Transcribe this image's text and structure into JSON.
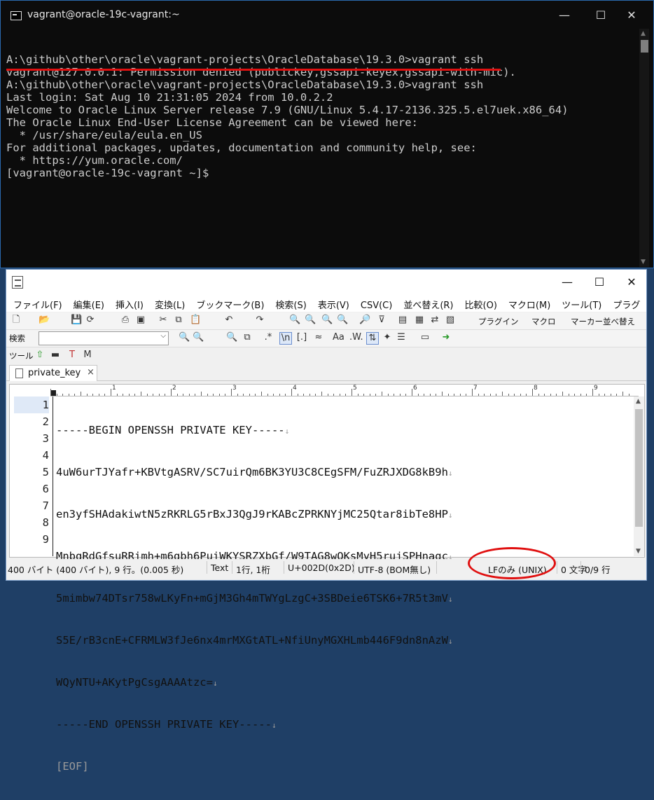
{
  "terminal": {
    "title": "vagrant@oracle-19c-vagrant:~",
    "lines": [
      "A:\\github\\other\\oracle\\vagrant-projects\\OracleDatabase\\19.3.0>vagrant ssh",
      "vagrant@127.0.0.1: Permission denied (publickey,gssapi-keyex,gssapi-with-mic).",
      "",
      "A:\\github\\other\\oracle\\vagrant-projects\\OracleDatabase\\19.3.0>vagrant ssh",
      "Last login: Sat Aug 10 21:31:05 2024 from 10.0.2.2",
      "",
      "Welcome to Oracle Linux Server release 7.9 (GNU/Linux 5.4.17-2136.325.5.el7uek.x86_64)",
      "",
      "The Oracle Linux End-User License Agreement can be viewed here:",
      "",
      "  * /usr/share/eula/eula.en_US",
      "",
      "For additional packages, updates, documentation and community help, see:",
      "",
      "  * https://yum.oracle.com/",
      "",
      "[vagrant@oracle-19c-vagrant ~]$"
    ],
    "window_buttons": {
      "minimize": "—",
      "maximize": "☐",
      "close": "✕"
    }
  },
  "editor": {
    "window_buttons": {
      "minimize": "—",
      "maximize": "☐",
      "close": "✕"
    },
    "menu": [
      "ファイル(F)",
      "編集(E)",
      "挿入(I)",
      "変換(L)",
      "ブックマーク(B)",
      "検索(S)",
      "表示(V)",
      "CSV(C)",
      "並べ替え(R)",
      "比較(O)",
      "マクロ(M)",
      "ツール(T)",
      "プラグ"
    ],
    "toolbar_labels": {
      "plugin": "プラグイン",
      "macro": "マクロ",
      "marker": "マーカー",
      "sort": "並べ替え"
    },
    "search": {
      "label": "検索",
      "value": ""
    },
    "tools_label": "ツール",
    "tab": {
      "name": "private_key",
      "close": "×"
    },
    "ruler_labels": [
      "1",
      "2",
      "3",
      "4",
      "5",
      "6",
      "7",
      "8",
      "9"
    ],
    "lines": [
      {
        "num": "1",
        "text": "-----BEGIN OPENSSH PRIVATE KEY-----"
      },
      {
        "num": "2",
        "text": "4uW6urTJYafr+KBVtgASRV/SC7uirQm6BK3YU3C8CEgSFM/FuZRJXDG8kB9h"
      },
      {
        "num": "3",
        "text": "en3yfSHAdakiwtN5zRKRLG5rBxJ3QgJ9rKABcZPRKNYjMC25Qtar8ibTe8HP"
      },
      {
        "num": "4",
        "text": "MnbgRdGfsuRRimh+m6gbh6PuiWKYSRZXbGf/W9TAG8wQKsMyH5rujSPHnagc"
      },
      {
        "num": "5",
        "text": "5mimbw74DTsr758wLKyFn+mGjM3Gh4mTWYgLzgC+3SBDeie6TSK6+7R5t3mV"
      },
      {
        "num": "6",
        "text": "S5E/rB3cnE+CFRMLW3fJe6nx4mrMXGtATL+NfiUnyMGXHLmb446F9dn8nAzW"
      },
      {
        "num": "7",
        "text": "WQyNTU+AKytPgCsgAAAAtzc="
      },
      {
        "num": "8",
        "text": "-----END OPENSSH PRIVATE KEY-----"
      },
      {
        "num": "9",
        "text": "[EOF]"
      }
    ],
    "eol_mark": "↓",
    "status": {
      "size": "400 バイト (400 バイト), 9 行。(0.005 秒)",
      "mode": "Text",
      "position": "1行, 1桁",
      "char": "U+002D(0x2D)",
      "encoding": "UTF-8 (BOM無し)",
      "newline": "LFのみ (UNIX)",
      "selection": "0 文字",
      "lines": "0/9 行"
    }
  }
}
